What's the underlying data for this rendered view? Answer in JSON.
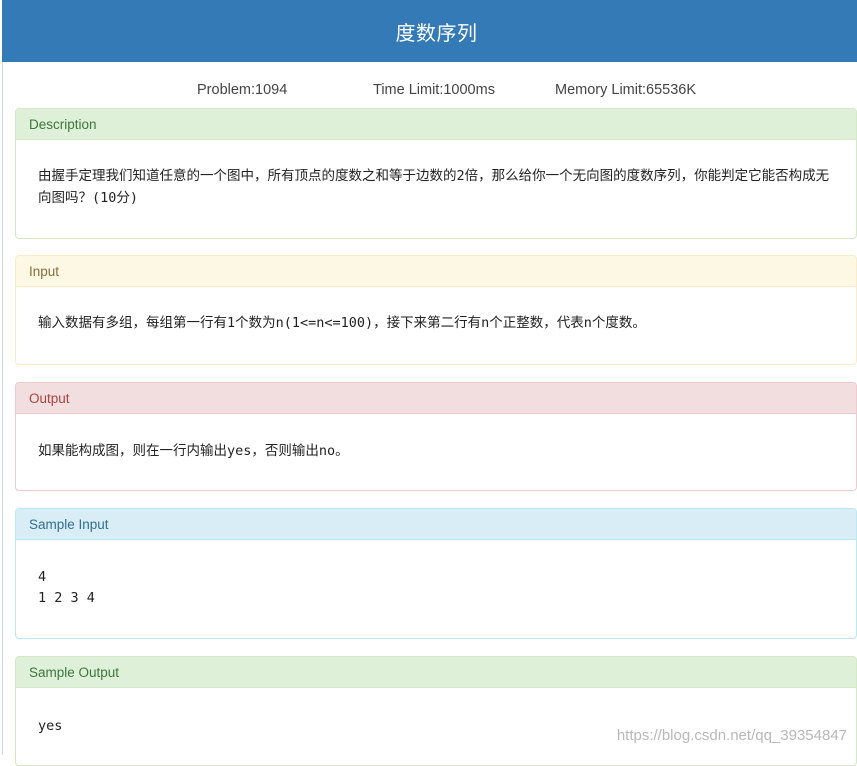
{
  "header": {
    "title": "度数序列"
  },
  "meta": {
    "problem": "Problem:1094",
    "time_limit": "Time Limit:1000ms",
    "memory_limit": "Memory Limit:65536K"
  },
  "panels": {
    "description": {
      "heading": "Description",
      "body": "由握手定理我们知道任意的一个图中，所有顶点的度数之和等于边数的2倍，那么给你一个无向图的度数序列，你能判定它能否构成无向图吗？(10分)"
    },
    "input": {
      "heading": "Input",
      "body": "输入数据有多组，每组第一行有1个数为n(1<=n<=100)，接下来第二行有n个正整数，代表n个度数。"
    },
    "output": {
      "heading": "Output",
      "body": "如果能构成图，则在一行内输出yes，否则输出no。"
    },
    "sample_input": {
      "heading": "Sample Input",
      "lines": [
        "4",
        "1 2 3 4"
      ]
    },
    "sample_output": {
      "heading": "Sample Output",
      "lines": [
        "yes"
      ]
    }
  },
  "watermark": "https://blog.csdn.net/qq_39354847",
  "colors": {
    "title_bar": "#337ab7",
    "success": "#dff0d8",
    "warning": "#fcf8e3",
    "danger": "#f2dede",
    "info": "#d9edf7"
  }
}
